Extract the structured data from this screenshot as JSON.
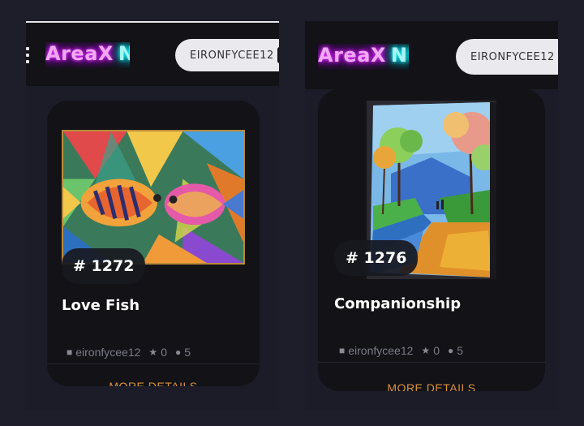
{
  "screens": [
    {
      "header": {
        "logo_primary": "AreaX",
        "logo_secondary": "NI",
        "username": "EIRONFYCEE12"
      },
      "card": {
        "number": "# 1272",
        "title": "Love Fish",
        "author": "eironfycee12",
        "stars": "0",
        "comments": "5",
        "button": "MORE DETAILS"
      }
    },
    {
      "header": {
        "logo_primary": "AreaX",
        "logo_secondary": "NI",
        "username": "EIRONFYCEE12"
      },
      "card": {
        "number": "# 1276",
        "title": "Companionship",
        "author": "eironfycee12",
        "stars": "0",
        "comments": "5",
        "button": "MORE DETAILS"
      }
    }
  ],
  "colors": {
    "background": "#1d1e2a",
    "card": "#121217",
    "accent": "#d8903a",
    "logo_pink": "#e040fb",
    "logo_cyan": "#18ffff"
  }
}
